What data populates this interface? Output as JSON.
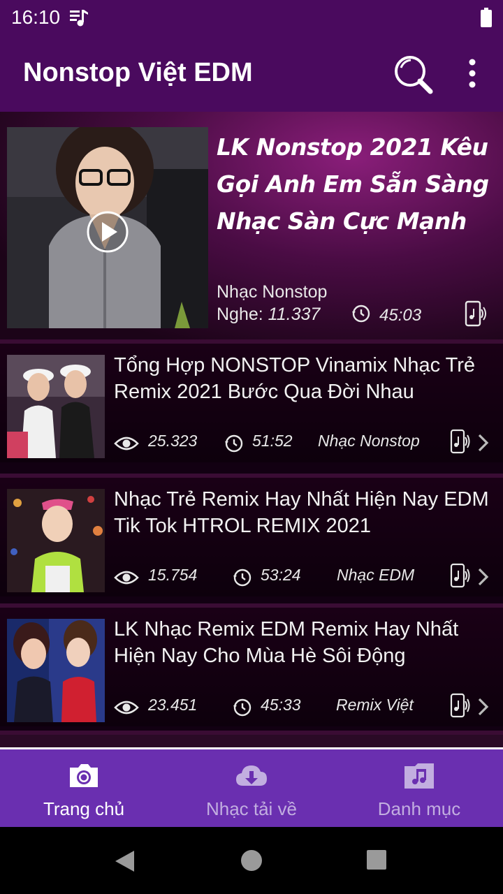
{
  "status_bar": {
    "time": "16:10",
    "icons": [
      "music-queue-icon",
      "battery-icon"
    ]
  },
  "app_bar": {
    "title": "Nonstop Việt EDM",
    "icons": [
      "search-icon",
      "more-vert-icon"
    ]
  },
  "featured": {
    "title": "LK Nonstop 2021 Kêu Gọi Anh Em Sẵn Sàng Nhạc Sàn Cực Mạnh",
    "category": "Nhạc Nonstop",
    "listen_label": "Nghe: ",
    "listens": "11.337",
    "duration": "45:03"
  },
  "items": [
    {
      "title": "Tổng Hợp NONSTOP Vinamix  Nhạc Trẻ Remix 2021 Bước Qua Đời Nhau",
      "views": "25.323",
      "duration": "51:52",
      "category": "Nhạc Nonstop"
    },
    {
      "title": "Nhạc Trẻ Remix Hay Nhất Hiện Nay EDM Tik Tok HTROL REMIX 2021",
      "views": "15.754",
      "duration": "53:24",
      "category": "Nhạc EDM"
    },
    {
      "title": "LK Nhạc Remix EDM Remix Hay Nhất Hiện Nay Cho Mùa Hè Sôi Động",
      "views": "23.451",
      "duration": "45:33",
      "category": "Remix Việt"
    }
  ],
  "bottom_nav": [
    {
      "label": "Trang chủ",
      "icon": "home-camera-icon",
      "active": true
    },
    {
      "label": "Nhạc tải về",
      "icon": "cloud-download-icon",
      "active": false
    },
    {
      "label": "Danh mục",
      "icon": "music-folder-icon",
      "active": false
    }
  ],
  "colors": {
    "header": "#4a0a5e",
    "bottom_nav": "#6a2fb0",
    "content_bg": "#120012"
  }
}
